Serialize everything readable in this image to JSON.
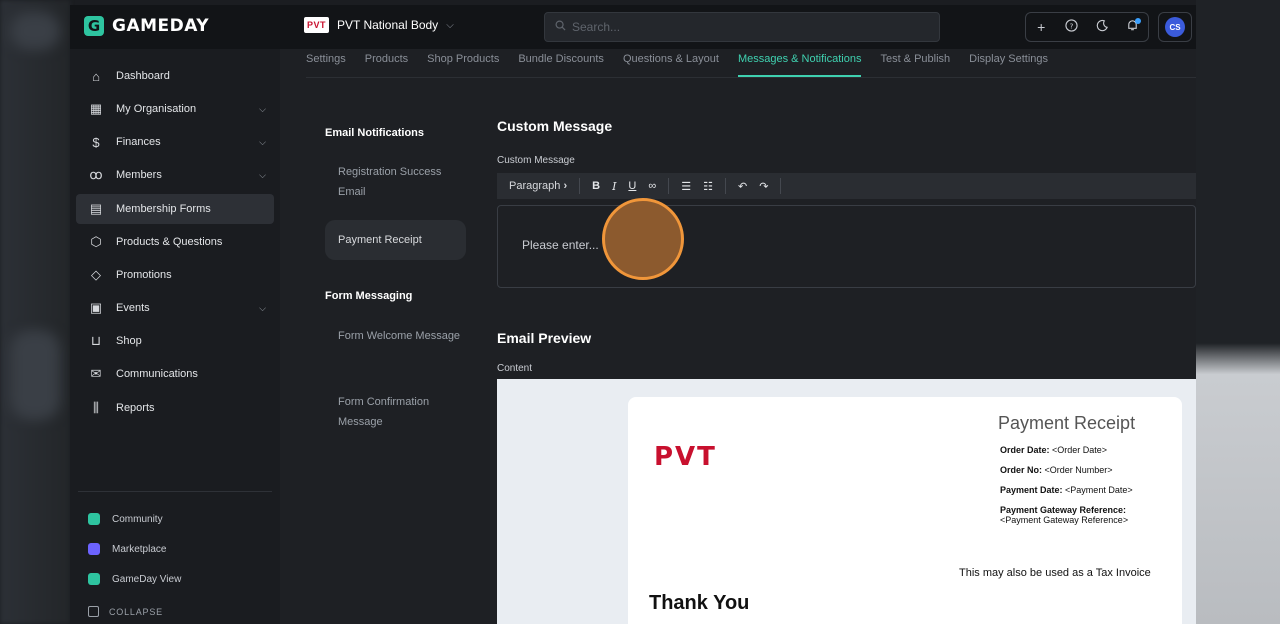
{
  "app": {
    "brand": "GAMEDAY",
    "org_badge": "PVT",
    "org_name": "PVT National Body",
    "search_placeholder": "Search..."
  },
  "user": {
    "initials": "CS"
  },
  "sidebar": {
    "items": [
      {
        "label": "Dashboard",
        "icon": "home-icon"
      },
      {
        "label": "My Organisation",
        "icon": "building-icon"
      },
      {
        "label": "Finances",
        "icon": "dollar-icon"
      },
      {
        "label": "Members",
        "icon": "users-icon"
      },
      {
        "label": "Membership Forms",
        "icon": "clipboard-icon"
      },
      {
        "label": "Products & Questions",
        "icon": "box-icon"
      },
      {
        "label": "Promotions",
        "icon": "tag-icon"
      },
      {
        "label": "Events",
        "icon": "calendar-icon"
      },
      {
        "label": "Shop",
        "icon": "cart-icon"
      },
      {
        "label": "Communications",
        "icon": "mail-icon"
      },
      {
        "label": "Reports",
        "icon": "bar-chart-icon"
      }
    ],
    "extras": [
      {
        "label": "Community",
        "color": "#2ec4a0"
      },
      {
        "label": "Marketplace",
        "color": "#6c63ff"
      },
      {
        "label": "GameDay View",
        "color": "#2ec4a0"
      }
    ],
    "collapse": "COLLAPSE"
  },
  "tabs": [
    "Settings",
    "Products",
    "Shop Products",
    "Bundle Discounts",
    "Questions & Layout",
    "Messages & Notifications",
    "Test & Publish",
    "Display Settings"
  ],
  "subnav": {
    "email_head": "Email Notifications",
    "email_items": [
      "Registration Success Email",
      "Payment Receipt"
    ],
    "form_head": "Form Messaging",
    "form_items": [
      "Form Welcome Message",
      "Form Confirmation Message"
    ]
  },
  "main": {
    "custom_title": "Custom Message",
    "custom_label": "Custom Message",
    "paragraph": "Paragraph",
    "editor_text": "Please enter...",
    "preview_title": "Email Preview",
    "preview_label": "Content"
  },
  "receipt": {
    "logo": "PVT",
    "title": "Payment Receipt",
    "order_date_label": "Order Date:",
    "order_date_value": "<Order Date>",
    "order_no_label": "Order No:",
    "order_no_value": "<Order Number>",
    "payment_date_label": "Payment Date:",
    "payment_date_value": "<Payment Date>",
    "gateway_label": "Payment Gateway Reference:",
    "gateway_value": "<Payment Gateway Reference>",
    "tax_note": "This may also be used as a Tax Invoice",
    "thanks": "Thank You"
  }
}
